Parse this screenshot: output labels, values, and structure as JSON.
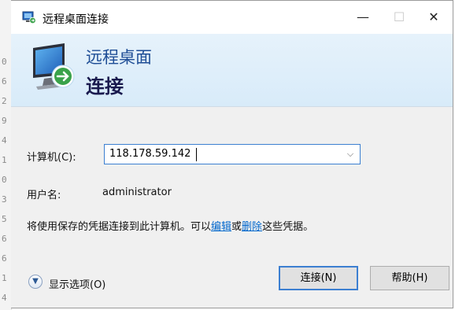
{
  "background_digits": [
    "0",
    "6",
    "2",
    "9",
    "4",
    "1",
    "0",
    "3",
    "5",
    "6",
    "6",
    "1",
    "4"
  ],
  "window": {
    "title": "远程桌面连接",
    "controls": {
      "minimize": "—",
      "maximize": "☐",
      "close": "✕"
    }
  },
  "banner": {
    "line1": "远程桌面",
    "line2": "连接"
  },
  "form": {
    "computer_label": "计算机(C):",
    "computer_value": "118.178.59.142",
    "username_label": "用户名:",
    "username_value": "administrator",
    "saved_creds_prefix": "将使用保存的凭据连接到此计算机。可以",
    "edit_link": "编辑",
    "or_text": "或",
    "delete_link": "删除",
    "saved_creds_suffix": "这些凭据。"
  },
  "footer": {
    "show_options": "显示选项(O)",
    "connect_button": "连接(N)",
    "help_button": "帮助(H)"
  },
  "colors": {
    "accent": "#3c7fd1",
    "banner_title": "#1f4e96",
    "link": "#0066cc"
  },
  "icons": {
    "app": "remote-desktop-icon",
    "banner": "monitor-connect-icon",
    "dropdown": "chevron-down-icon",
    "options": "expand-options-icon"
  }
}
